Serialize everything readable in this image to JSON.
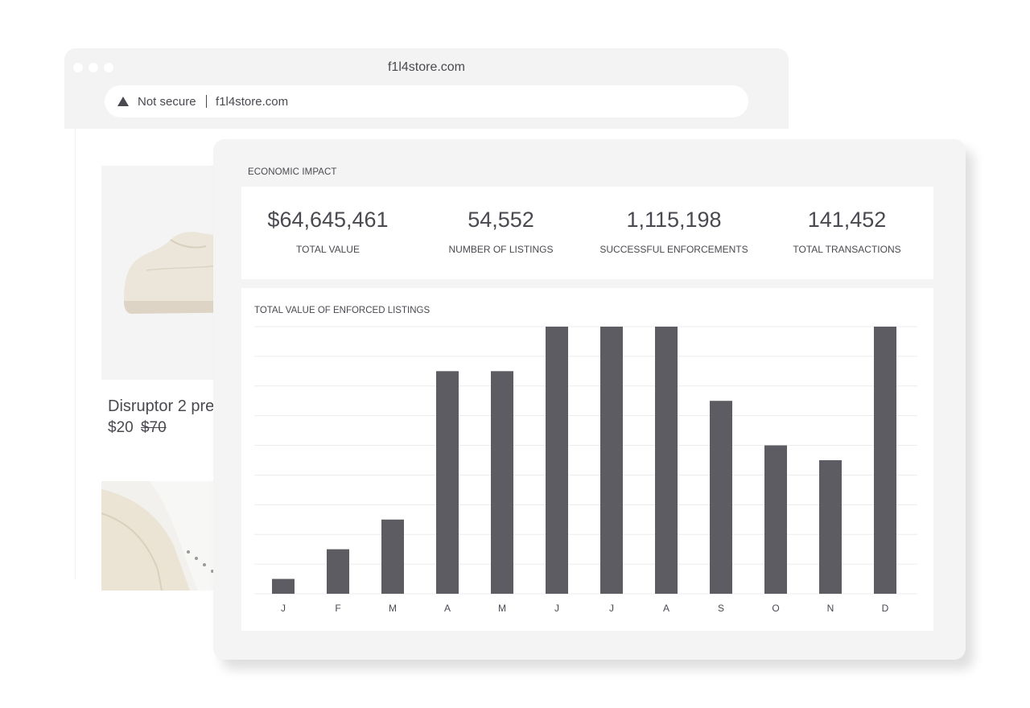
{
  "browser": {
    "window_title": "f1l4store.com",
    "security_label": "Not secure",
    "url": "f1l4store.com"
  },
  "product": {
    "name": "Disruptor 2 pre",
    "price": "$20",
    "original_price": "$70"
  },
  "dashboard": {
    "section_title": "ECONOMIC IMPACT",
    "stats": [
      {
        "value": "$64,645,461",
        "label": "TOTAL VALUE"
      },
      {
        "value": "54,552",
        "label": "NUMBER OF LISTINGS"
      },
      {
        "value": "1,115,198",
        "label": "SUCCESSFUL ENFORCEMENTS"
      },
      {
        "value": "141,452",
        "label": "TOTAL TRANSACTIONS"
      }
    ]
  },
  "colors": {
    "bar": "#5d5c63",
    "gridline": "#ececec",
    "text": "#4a4950"
  },
  "chart_data": {
    "type": "bar",
    "title": "TOTAL VALUE OF ENFORCED LISTINGS",
    "categories": [
      "J",
      "F",
      "M",
      "A",
      "M",
      "J",
      "J",
      "A",
      "S",
      "O",
      "N",
      "D"
    ],
    "values": [
      1,
      3,
      5,
      15,
      15,
      18,
      18,
      18,
      13,
      10,
      9,
      18
    ],
    "ylim": [
      0,
      18
    ],
    "grid": true,
    "xlabel": "",
    "ylabel": ""
  }
}
